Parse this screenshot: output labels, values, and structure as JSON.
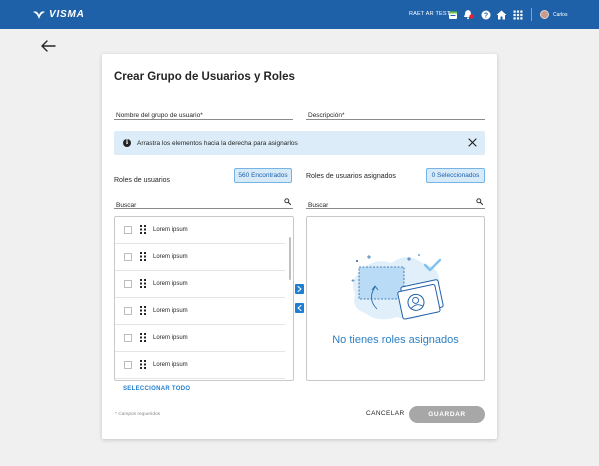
{
  "header": {
    "brand": "VISMA",
    "company": "RAET AR TEST",
    "username": "Carlos",
    "colors": {
      "bar": "#1f61a8",
      "notification": "#e5213b"
    }
  },
  "page": {
    "title": "Crear Grupo de Usuarios y Roles",
    "fields": {
      "group_name_placeholder": "Nombre del grupo de usuario*",
      "description_placeholder": "Descripción*"
    },
    "info_banner": "Arrastra los elementos hacia la derecha para asignarlos",
    "available": {
      "label": "Roles de usuarios",
      "badge": "560 Encontrados",
      "search_placeholder": "Buscar",
      "items": [
        {
          "label": "Lorem ipsum"
        },
        {
          "label": "Lorem ipsum"
        },
        {
          "label": "Lorem ipsum"
        },
        {
          "label": "Lorem ipsum"
        },
        {
          "label": "Lorem ipsum"
        },
        {
          "label": "Lorem ipsum"
        }
      ],
      "select_all": "SELECCIONAR TODO"
    },
    "assigned": {
      "label": "Roles de usuarios asignados",
      "badge": "0 Seleccionados",
      "search_placeholder": "Buscar",
      "empty_text": "No tienes roles asignados"
    },
    "required_note": "* Campos requeridos",
    "actions": {
      "cancel": "CANCELAR",
      "save": "GUARDAR"
    }
  }
}
